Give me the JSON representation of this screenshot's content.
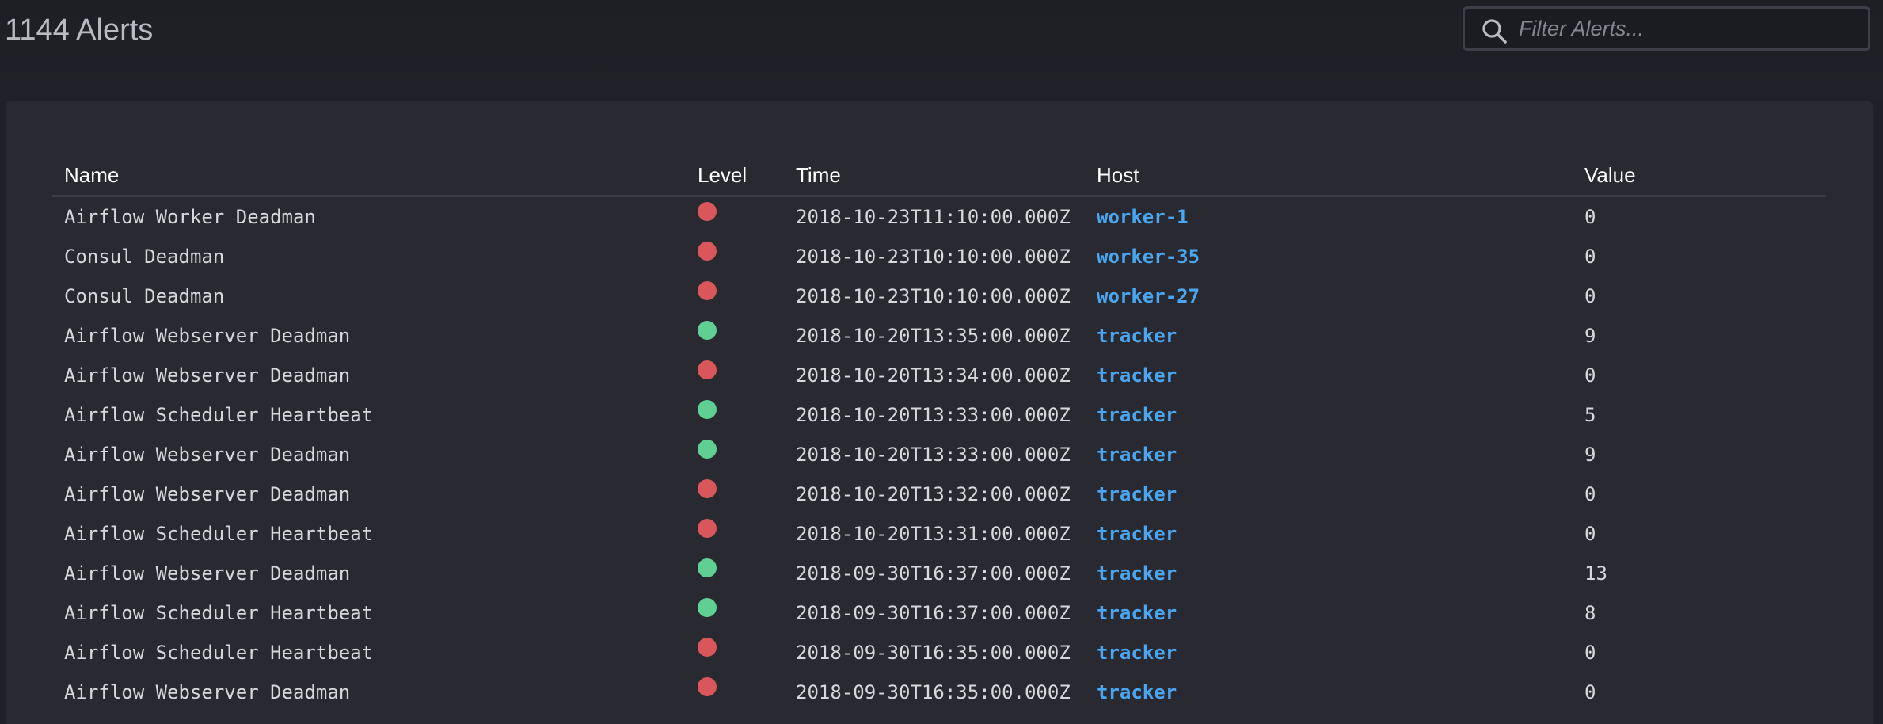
{
  "header": {
    "title": "1144 Alerts",
    "search_placeholder": "Filter Alerts..."
  },
  "colors": {
    "critical": "#d9575a",
    "ok": "#5fcf94",
    "link": "#4aa6f0"
  },
  "table": {
    "columns": [
      "Name",
      "Level",
      "Time",
      "Host",
      "Value"
    ],
    "rows": [
      {
        "name": "Airflow Worker Deadman",
        "level": "critical",
        "time": "2018-10-23T11:10:00.000Z",
        "host": "worker-1",
        "value": "0"
      },
      {
        "name": "Consul Deadman",
        "level": "critical",
        "time": "2018-10-23T10:10:00.000Z",
        "host": "worker-35",
        "value": "0"
      },
      {
        "name": "Consul Deadman",
        "level": "critical",
        "time": "2018-10-23T10:10:00.000Z",
        "host": "worker-27",
        "value": "0"
      },
      {
        "name": "Airflow Webserver Deadman",
        "level": "ok",
        "time": "2018-10-20T13:35:00.000Z",
        "host": "tracker",
        "value": "9"
      },
      {
        "name": "Airflow Webserver Deadman",
        "level": "critical",
        "time": "2018-10-20T13:34:00.000Z",
        "host": "tracker",
        "value": "0"
      },
      {
        "name": "Airflow Scheduler Heartbeat",
        "level": "ok",
        "time": "2018-10-20T13:33:00.000Z",
        "host": "tracker",
        "value": "5"
      },
      {
        "name": "Airflow Webserver Deadman",
        "level": "ok",
        "time": "2018-10-20T13:33:00.000Z",
        "host": "tracker",
        "value": "9"
      },
      {
        "name": "Airflow Webserver Deadman",
        "level": "critical",
        "time": "2018-10-20T13:32:00.000Z",
        "host": "tracker",
        "value": "0"
      },
      {
        "name": "Airflow Scheduler Heartbeat",
        "level": "critical",
        "time": "2018-10-20T13:31:00.000Z",
        "host": "tracker",
        "value": "0"
      },
      {
        "name": "Airflow Webserver Deadman",
        "level": "ok",
        "time": "2018-09-30T16:37:00.000Z",
        "host": "tracker",
        "value": "13"
      },
      {
        "name": "Airflow Scheduler Heartbeat",
        "level": "ok",
        "time": "2018-09-30T16:37:00.000Z",
        "host": "tracker",
        "value": "8"
      },
      {
        "name": "Airflow Scheduler Heartbeat",
        "level": "critical",
        "time": "2018-09-30T16:35:00.000Z",
        "host": "tracker",
        "value": "0"
      },
      {
        "name": "Airflow Webserver Deadman",
        "level": "critical",
        "time": "2018-09-30T16:35:00.000Z",
        "host": "tracker",
        "value": "0"
      }
    ]
  }
}
